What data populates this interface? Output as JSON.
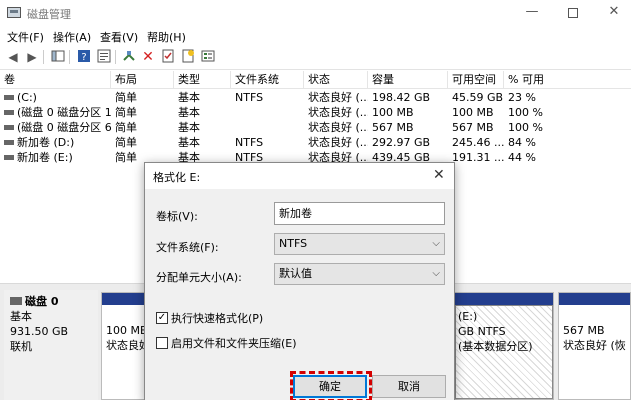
{
  "window": {
    "title": "磁盘管理",
    "minimize": "—",
    "close": "✕"
  },
  "menu": [
    "文件(F)",
    "操作(A)",
    "查看(V)",
    "帮助(H)"
  ],
  "toolbar": {
    "icons": [
      "back-arrow-icon",
      "forward-arrow-icon",
      "console-tree-icon",
      "help-icon",
      "properties-icon",
      "connect-icon",
      "delete-icon",
      "check-icon",
      "new-icon",
      "options-icon"
    ]
  },
  "table": {
    "columns": [
      "卷",
      "布局",
      "类型",
      "文件系统",
      "状态",
      "容量",
      "可用空间",
      "% 可用"
    ],
    "rows": [
      [
        "(C:)",
        "简单",
        "基本",
        "NTFS",
        "状态良好 (...",
        "198.42 GB",
        "45.59 GB",
        "23 %"
      ],
      [
        "(磁盘 0 磁盘分区 1)",
        "简单",
        "基本",
        "",
        "状态良好 (...",
        "100 MB",
        "100 MB",
        "100 %"
      ],
      [
        "(磁盘 0 磁盘分区 6)",
        "简单",
        "基本",
        "",
        "状态良好 (...",
        "567 MB",
        "567 MB",
        "100 %"
      ],
      [
        "新加卷 (D:)",
        "简单",
        "基本",
        "NTFS",
        "状态良好 (...",
        "292.97 GB",
        "245.46 ...",
        "84 %"
      ],
      [
        "新加卷 (E:)",
        "简单",
        "基本",
        "NTFS",
        "状态良好 (...",
        "439.45 GB",
        "191.31 ...",
        "44 %"
      ]
    ]
  },
  "disk": {
    "name": "磁盘 0",
    "type": "基本",
    "size": "931.50 GB",
    "status": "联机"
  },
  "partitions": [
    {
      "line1": "100 MB",
      "line2": "状态良好"
    },
    {
      "line1": "(E:)",
      "line2": "GB NTFS",
      "line3": "(基本数据分区)"
    },
    {
      "line1": "567 MB",
      "line2": "状态良好 (恢"
    }
  ],
  "dialog": {
    "title": "格式化 E:",
    "close": "✕",
    "volume_label_text": "卷标(V):",
    "volume_label_value": "新加卷",
    "fs_label": "文件系统(F):",
    "fs_value": "NTFS",
    "alloc_label": "分配单元大小(A):",
    "alloc_value": "默认值",
    "quick_format": "执行快速格式化(P)",
    "quick_format_checked": true,
    "compress": "启用文件和文件夹压缩(E)",
    "compress_checked": false,
    "ok": "确定",
    "cancel": "取消"
  },
  "colors": {
    "partition_band": "#233e8e",
    "highlight": "#d40000",
    "default_button": "#0078d7"
  }
}
